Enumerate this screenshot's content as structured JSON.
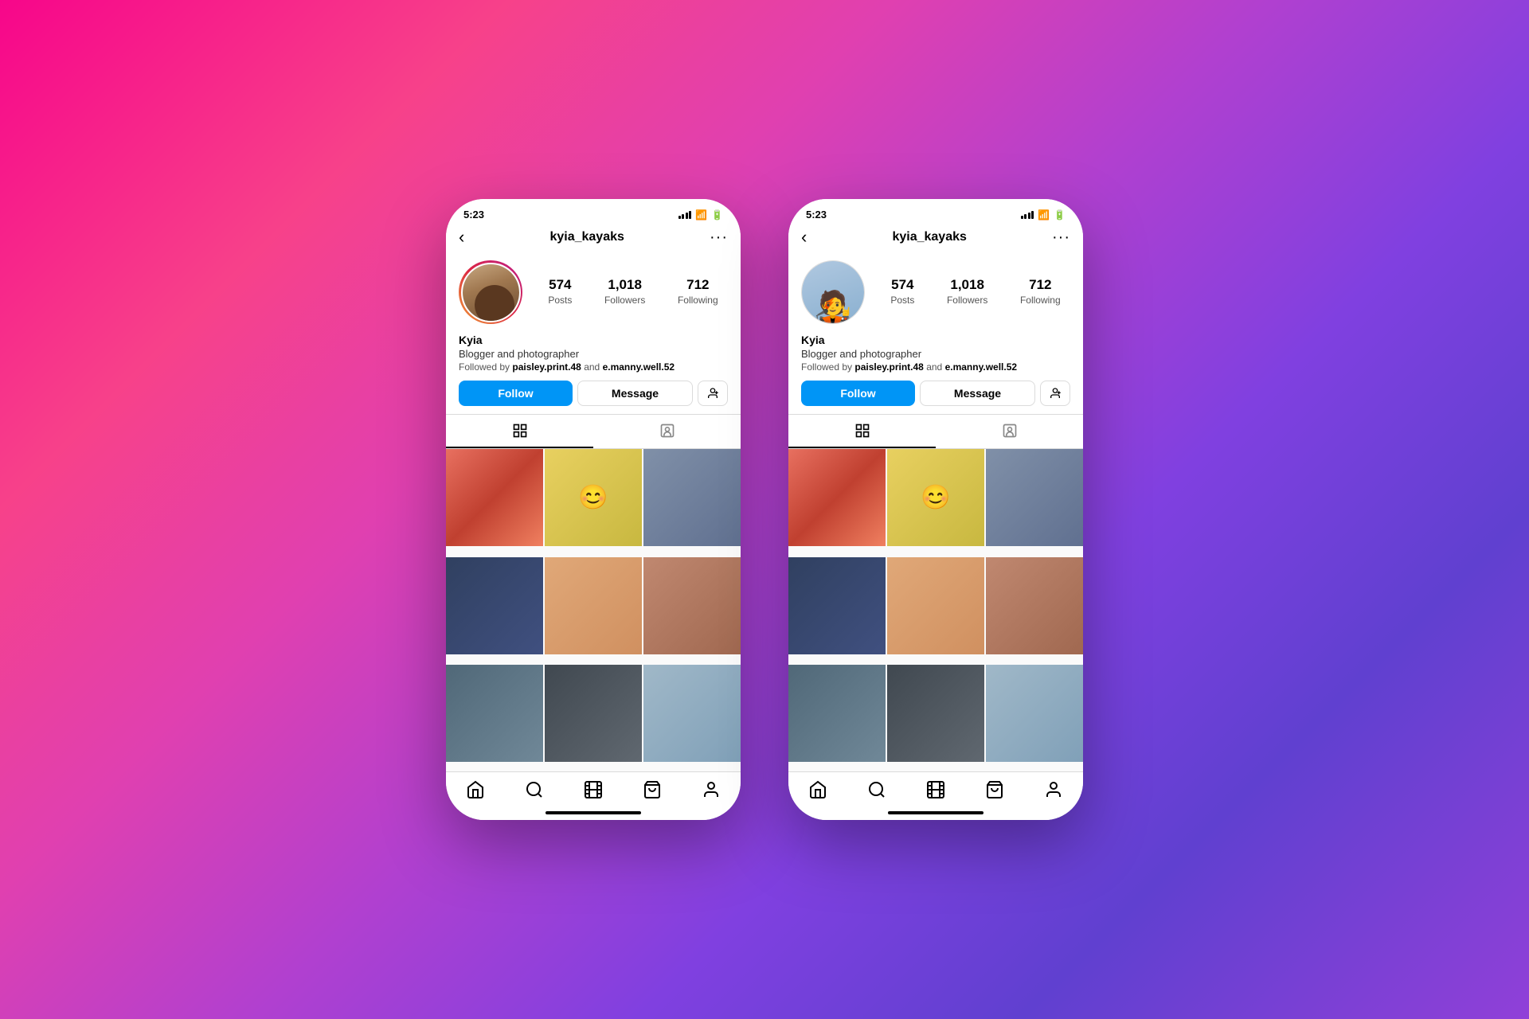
{
  "background": {
    "gradient": "linear-gradient(135deg, #f7068a, #f7418a, #e040b0, #b040d0, #8040e0, #6040d0, #9040d8)"
  },
  "phones": [
    {
      "id": "phone-left",
      "status_bar": {
        "time": "5:23",
        "signal": "●●●",
        "wifi": "wifi",
        "battery": "battery"
      },
      "header": {
        "back_label": "‹",
        "username": "kyia_kayaks",
        "more_label": "···"
      },
      "profile": {
        "avatar_type": "photo",
        "has_story_ring": true,
        "name": "Kyia",
        "bio": "Blogger and photographer",
        "followed_by_text": "Followed by",
        "followed_by_users": "paisley.print.48 and e.manny.well.52",
        "stats": [
          {
            "number": "574",
            "label": "Posts"
          },
          {
            "number": "1,018",
            "label": "Followers"
          },
          {
            "number": "712",
            "label": "Following"
          }
        ]
      },
      "buttons": {
        "follow_label": "Follow",
        "message_label": "Message",
        "add_person_label": "➕"
      },
      "tabs": [
        {
          "icon": "⊞",
          "active": true
        },
        {
          "icon": "👤",
          "active": false
        }
      ],
      "grid_photos": [
        "photo-1",
        "photo-2",
        "photo-3",
        "photo-4",
        "photo-5",
        "photo-6",
        "photo-7",
        "photo-8",
        "photo-9"
      ],
      "bottom_nav": {
        "home": "🏠",
        "search": "🔍",
        "reels": "▶",
        "shop": "🛍",
        "profile": "👤"
      }
    },
    {
      "id": "phone-right",
      "status_bar": {
        "time": "5:23",
        "signal": "●●●",
        "wifi": "wifi",
        "battery": "battery"
      },
      "header": {
        "back_label": "‹",
        "username": "kyia_kayaks",
        "more_label": "···"
      },
      "profile": {
        "avatar_type": "cartoon",
        "has_story_ring": false,
        "name": "Kyia",
        "bio": "Blogger and photographer",
        "followed_by_text": "Followed by",
        "followed_by_users": "paisley.print.48 and e.manny.well.52",
        "stats": [
          {
            "number": "574",
            "label": "Posts"
          },
          {
            "number": "1,018",
            "label": "Followers"
          },
          {
            "number": "712",
            "label": "Following"
          }
        ]
      },
      "buttons": {
        "follow_label": "Follow",
        "message_label": "Message",
        "add_person_label": "➕"
      },
      "tabs": [
        {
          "icon": "⊞",
          "active": true
        },
        {
          "icon": "👤",
          "active": false
        }
      ],
      "grid_photos": [
        "photo-1",
        "photo-2",
        "photo-3",
        "photo-4",
        "photo-5",
        "photo-6",
        "photo-7",
        "photo-8",
        "photo-9"
      ],
      "bottom_nav": {
        "home": "🏠",
        "search": "🔍",
        "reels": "▶",
        "shop": "🛍",
        "profile": "👤"
      }
    }
  ]
}
